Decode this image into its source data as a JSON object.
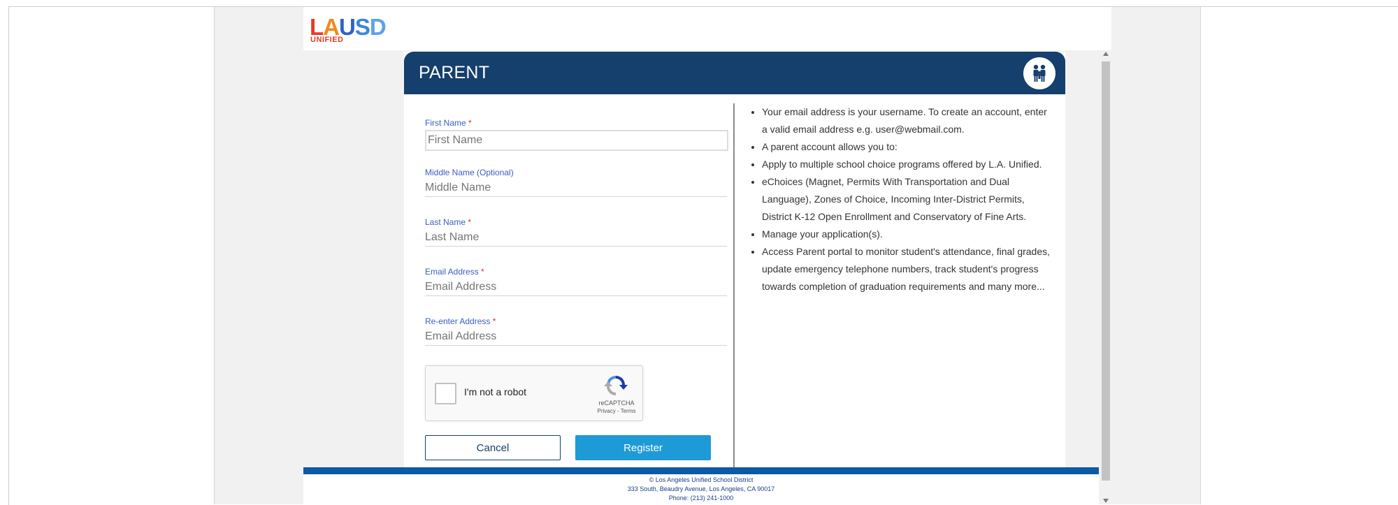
{
  "logo": {
    "mark_letters": [
      "L",
      "A",
      "U",
      "S",
      "D"
    ],
    "sub": "UNIFIED"
  },
  "card": {
    "title": "PARENT",
    "icon": "family-icon"
  },
  "form": {
    "first_name": {
      "label": "First Name",
      "required_mark": "*",
      "placeholder": "First Name"
    },
    "middle_name": {
      "label": "Middle Name (Optional)",
      "placeholder": "Middle Name"
    },
    "last_name": {
      "label": "Last Name",
      "required_mark": "*",
      "placeholder": "Last Name"
    },
    "email": {
      "label": "Email Address",
      "required_mark": "*",
      "placeholder": "Email Address"
    },
    "reenter_email": {
      "label": "Re-enter Address",
      "required_mark": "*",
      "placeholder": "Email Address"
    }
  },
  "captcha": {
    "label": "I'm not a robot",
    "brand": "reCAPTCHA",
    "links": "Privacy - Terms"
  },
  "buttons": {
    "cancel": "Cancel",
    "register": "Register"
  },
  "info": {
    "items": [
      "Your email address is your username. To create an account, enter a valid email address e.g. user@webmail.com.",
      "A parent account allows you to:",
      "Apply to multiple school choice programs offered by L.A. Unified.",
      "eChoices (Magnet, Permits With Transportation and Dual Language), Zones of Choice, Incoming Inter-District Permits, District K-12 Open Enrollment and Conservatory of Fine Arts.",
      "Manage your application(s).",
      "Access Parent portal to monitor student's attendance, final grades, update emergency telephone numbers, track student's progress towards completion of graduation requirements and many more..."
    ]
  },
  "footer": {
    "copyright": "© Los Angeles Unified School District",
    "address": "333 South, Beaudry Avenue, Los Angeles, CA 90017",
    "phone": "Phone: (213) 241-1000"
  },
  "colors": {
    "header": "#153f6c",
    "register": "#1e9ad6",
    "footer_bar": "#0b5aa5",
    "label": "#3a5ec2"
  }
}
